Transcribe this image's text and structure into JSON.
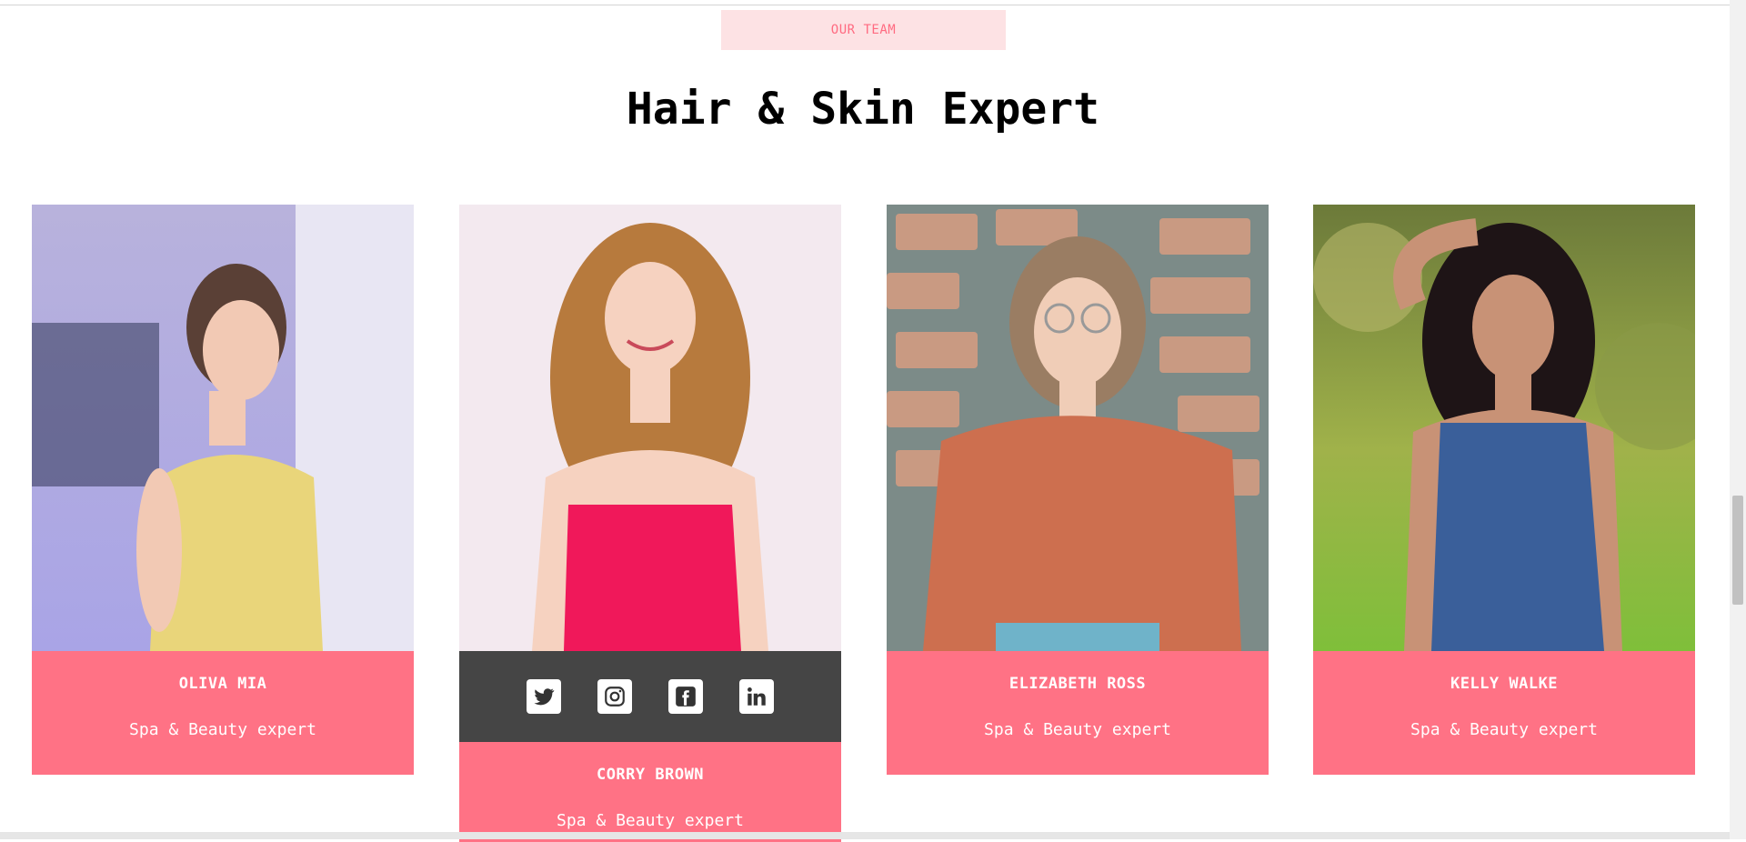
{
  "section": {
    "eyebrow": "OUR TEAM",
    "title": "Hair & Skin Expert"
  },
  "team": [
    {
      "name": "OLIVA MIA",
      "role": "Spa & Beauty expert",
      "photo_icon": "woman-portrait-yellow-dress"
    },
    {
      "name": "CORRY BROWN",
      "role": "Spa & Beauty expert",
      "photo_icon": "woman-portrait-pink-top"
    },
    {
      "name": "ELIZABETH ROSS",
      "role": "Spa & Beauty expert",
      "photo_icon": "woman-portrait-glasses-brick-wall"
    },
    {
      "name": "KELLY WALKE",
      "role": "Spa & Beauty expert",
      "photo_icon": "woman-portrait-blue-tank-park"
    }
  ],
  "social": [
    "twitter-icon",
    "instagram-icon",
    "facebook-icon",
    "linkedin-icon"
  ],
  "colors": {
    "accent": "#ff7285",
    "eyebrow_bg": "#fde2e4",
    "eyebrow_text": "#ff6b81",
    "social_bar": "#454545"
  }
}
